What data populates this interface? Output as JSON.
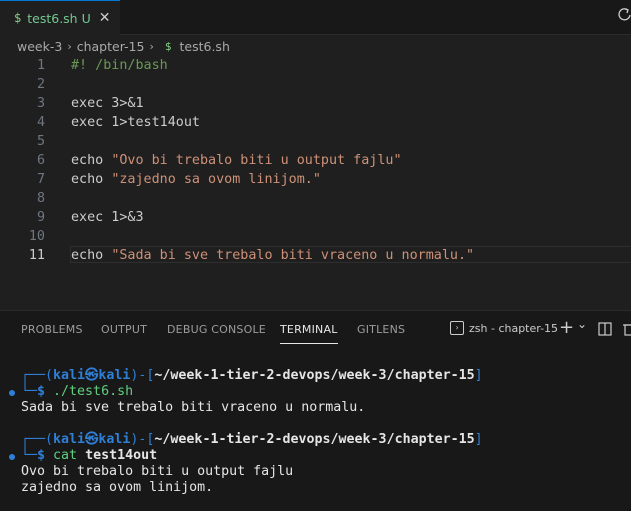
{
  "tab": {
    "icon": "$",
    "filename": "test6.sh",
    "status": "U",
    "close": "✕"
  },
  "breadcrumb": {
    "parts": [
      "week-3",
      "chapter-15"
    ],
    "file_icon": "$",
    "file": "test6.sh"
  },
  "editor": {
    "lines": [
      {
        "n": "1",
        "text": "#! /bin/bash"
      },
      {
        "n": "2",
        "text": ""
      },
      {
        "n": "3",
        "text": "exec 3>&1"
      },
      {
        "n": "4",
        "text": "exec 1>test14out"
      },
      {
        "n": "5",
        "text": ""
      },
      {
        "n": "6",
        "kw": "echo ",
        "str": "\"Ovo bi trebalo biti u output fajlu\""
      },
      {
        "n": "7",
        "kw": "echo ",
        "str": "\"zajedno sa ovom linijom.\""
      },
      {
        "n": "8",
        "text": ""
      },
      {
        "n": "9",
        "text": "exec 1>&3"
      },
      {
        "n": "10",
        "text": ""
      },
      {
        "n": "11",
        "kw": "echo ",
        "str": "\"Sada bi sve trebalo biti vraceno u normalu.\""
      }
    ]
  },
  "panel": {
    "tabs": [
      "PROBLEMS",
      "OUTPUT",
      "DEBUG CONSOLE",
      "TERMINAL",
      "GITLENS"
    ],
    "terminal_name": "zsh - chapter-15",
    "plus": "+",
    "chevron": "⌄"
  },
  "terminal": {
    "user": "kali㉿kali",
    "path": "~/week-1-tier-2-devops/week-3/chapter-15",
    "cmd1": "./test6.sh",
    "out1": "Sada bi sve trebalo biti vraceno u normalu.",
    "cmd2_a": "cat ",
    "cmd2_b": "test14out",
    "out2a": "Ovo bi trebalo biti u output fajlu",
    "out2b": "zajedno sa ovom linijom."
  }
}
